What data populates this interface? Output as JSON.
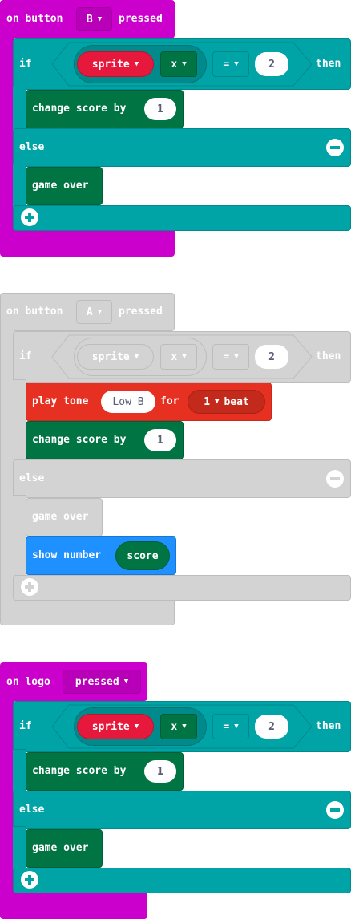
{
  "stack1": {
    "hat": {
      "prefix": "on button",
      "button": "B",
      "suffix": "pressed"
    },
    "if_label": "if",
    "then_label": "then",
    "sprite_var": "sprite",
    "prop": "x",
    "op": "=",
    "value": "2",
    "change_label": "change score by",
    "change_value": "1",
    "else_label": "else",
    "game_over": "game over"
  },
  "stack2": {
    "hat": {
      "prefix": "on button",
      "button": "A",
      "suffix": "pressed"
    },
    "if_label": "if",
    "then_label": "then",
    "sprite_var": "sprite",
    "prop": "x",
    "op": "=",
    "value": "2",
    "play_label": "play tone",
    "tone": "Low B",
    "for_label": "for",
    "beat_value": "1",
    "beat_label": "beat",
    "change_label": "change score by",
    "change_value": "1",
    "else_label": "else",
    "game_over": "game over",
    "show_label": "show number",
    "show_value": "score"
  },
  "stack3": {
    "hat": {
      "prefix": "on logo",
      "dropdown": "pressed"
    },
    "if_label": "if",
    "then_label": "then",
    "sprite_var": "sprite",
    "prop": "x",
    "op": "=",
    "value": "2",
    "change_label": "change score by",
    "change_value": "1",
    "else_label": "else",
    "game_over": "game over"
  },
  "colors": {
    "event": "#CC00CC",
    "logic": "#00A4A6",
    "game": "#007443",
    "variable": "#E63022",
    "music": "#E63022",
    "basic": "#1E90FF",
    "disabled": "#D3D3D3"
  }
}
